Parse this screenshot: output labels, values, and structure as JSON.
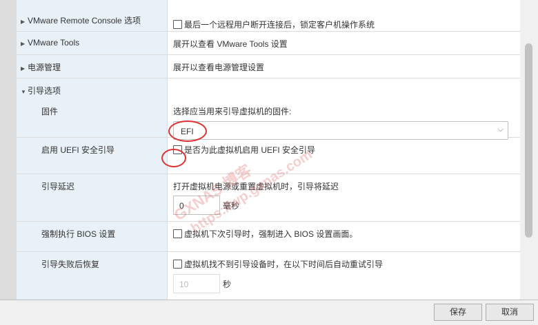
{
  "rows": {
    "remote_console": {
      "label": "VMware Remote Console 选项",
      "value": "最后一个远程用户断开连接后，锁定客户机操作系统"
    },
    "tools": {
      "label": "VMware Tools",
      "value": "展开以查看 VMware Tools 设置"
    },
    "power": {
      "label": "电源管理",
      "value": "展开以查看电源管理设置"
    },
    "boot": {
      "label": "引导选项"
    },
    "firmware": {
      "label": "固件",
      "desc": "选择应当用来引导虚拟机的固件:",
      "selected": "EFI"
    },
    "uefi_secure": {
      "label": "启用 UEFI 安全引导",
      "value": "是否为此虚拟机启用 UEFI 安全引导"
    },
    "boot_delay": {
      "label": "引导延迟",
      "desc": "打开虚拟机电源或重置虚拟机时，引导将延迟",
      "value": "0",
      "unit": "毫秒"
    },
    "force_bios": {
      "label": "强制执行 BIOS 设置",
      "value": "虚拟机下次引导时，强制进入 BIOS 设置画面。"
    },
    "boot_retry": {
      "label": "引导失败后恢复",
      "value": "虚拟机找不到引导设备时，在以下时间后自动重试引导",
      "retry_value": "10",
      "unit": "秒"
    }
  },
  "buttons": {
    "save": "保存",
    "cancel": "取消"
  },
  "watermark": {
    "line1": "GXNAS 博客",
    "line2": "https://wp.gxnas.com"
  },
  "colors": {
    "label_bg": "#e8f0f8",
    "annotation": "#e03030"
  }
}
